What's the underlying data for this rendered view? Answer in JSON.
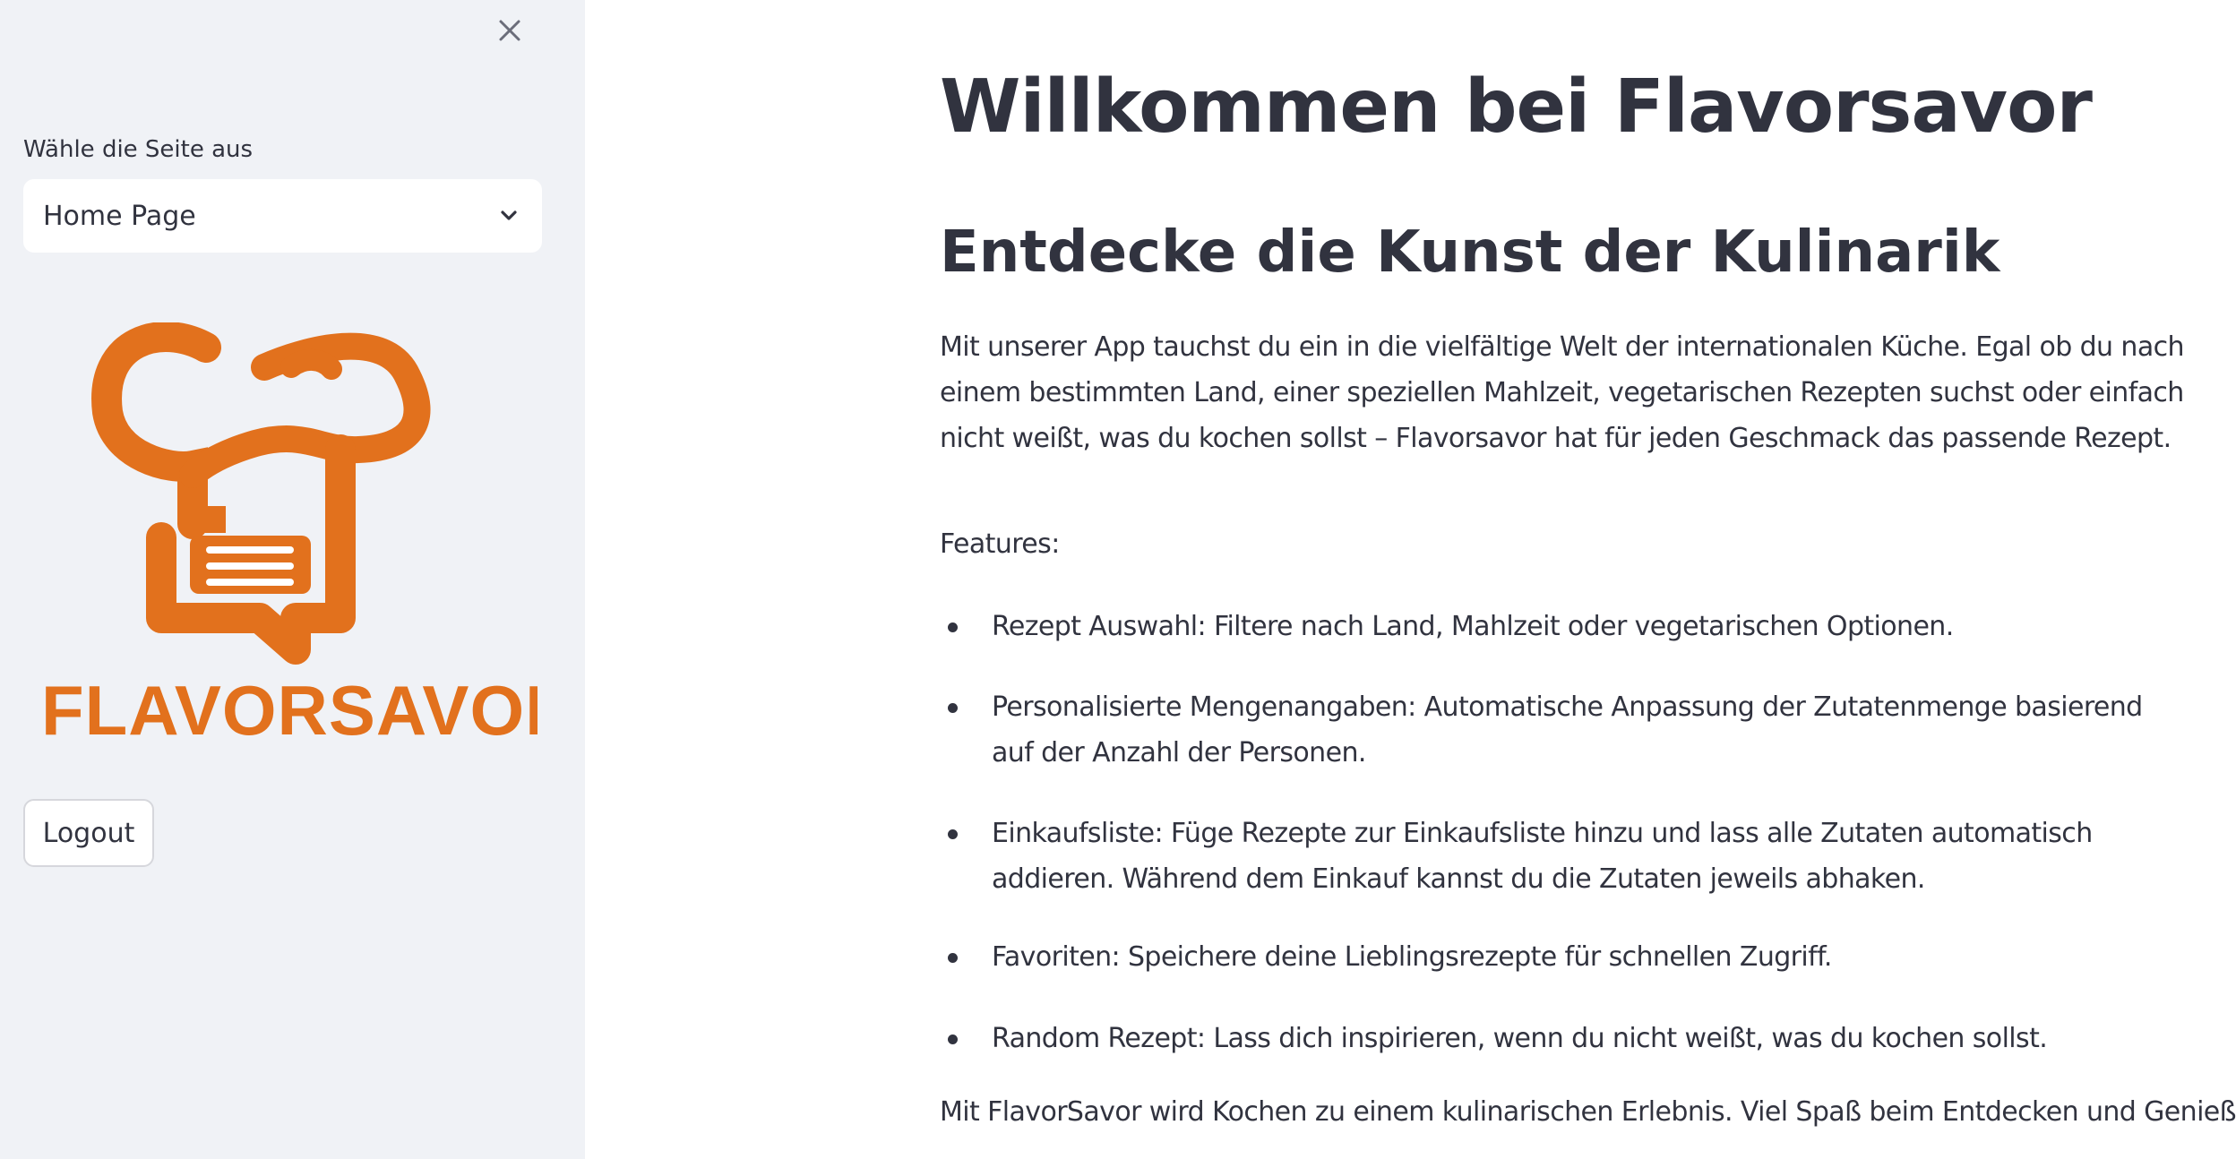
{
  "sidebar": {
    "select_label": "Wähle die Seite aus",
    "selected_page": "Home Page",
    "logo_text": "FLAVORSAVOR",
    "logout_label": "Logout",
    "colors": {
      "background": "#f0f2f6",
      "logo_orange": "#e2711d"
    }
  },
  "main": {
    "title": "Willkommen bei Flavorsavor",
    "subtitle": "Entdecke die Kunst der Kulinarik",
    "intro": "Mit unserer App tauchst du ein in die vielfältige Welt der internationalen Küche. Egal ob du nach einem bestimmten Land, einer speziellen Mahlzeit, vegetarischen Rezepten suchst oder einfach nicht weißt, was du kochen sollst – Flavorsavor hat für jeden Geschmack das passende Rezept.",
    "features_label": "Features:",
    "features": [
      "Rezept Auswahl: Filtere nach Land, Mahlzeit oder vegetarischen Optionen.",
      "Personalisierte Mengenangaben: Automatische Anpassung der Zutatenmenge basierend auf der Anzahl der Personen.",
      "Einkaufsliste: Füge Rezepte zur Einkaufsliste hinzu und lass alle Zutaten automatisch addieren. Während dem Einkauf kannst du die Zutaten jeweils abhaken.",
      "Favoriten: Speichere deine Lieblingsrezepte für schnellen Zugriff.",
      "Random Rezept: Lass dich inspirieren, wenn du nicht weißt, was du kochen sollst."
    ],
    "outro": "Mit FlavorSavor wird Kochen zu einem kulinarischen Erlebnis. Viel Spaß beim Entdecken und Genießen!"
  },
  "icons": {
    "close": "close-icon",
    "dropdown": "chevron-down-icon"
  }
}
